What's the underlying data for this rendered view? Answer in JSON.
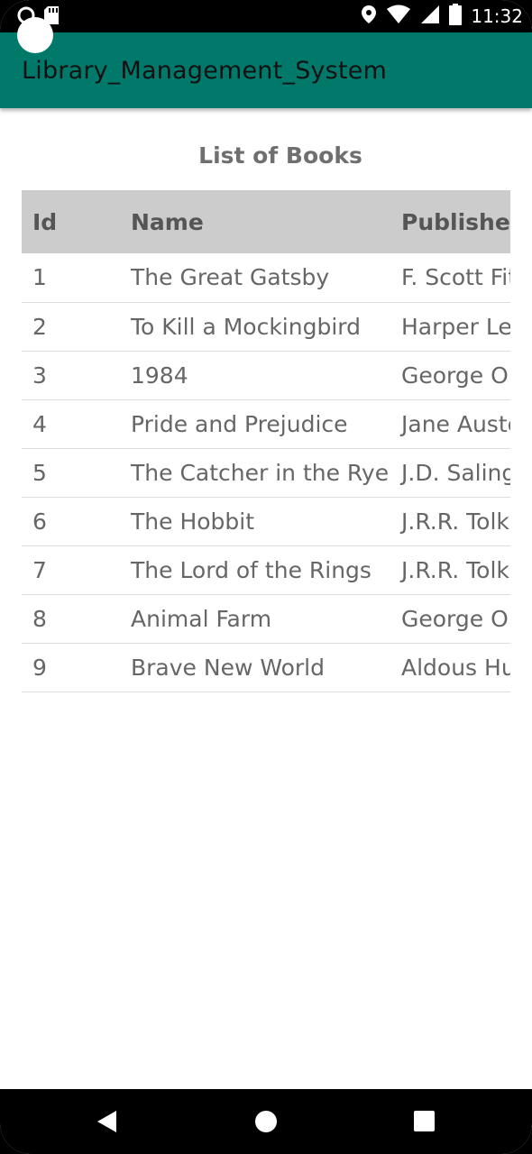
{
  "status_bar": {
    "time": "11:32",
    "icons": [
      "camera-notification-icon",
      "sd-card-icon",
      "location-icon",
      "wifi-icon",
      "signal-icon",
      "battery-icon"
    ]
  },
  "app_bar": {
    "title": "Library_Management_System",
    "color": "#00796b"
  },
  "content": {
    "title": "List of Books",
    "table": {
      "headers": {
        "id": "Id",
        "name": "Name",
        "publisher": "Publisher"
      },
      "rows": [
        {
          "id": "1",
          "name": "The Great Gatsby",
          "publisher": "F. Scott Fitzgerald"
        },
        {
          "id": "2",
          "name": "To Kill a Mockingbird",
          "publisher": "Harper Lee"
        },
        {
          "id": "3",
          "name": "1984",
          "publisher": "George Orwell"
        },
        {
          "id": "4",
          "name": "Pride and Prejudice",
          "publisher": "Jane Austen"
        },
        {
          "id": "5",
          "name": "The Catcher in the Rye",
          "publisher": "J.D. Salinger"
        },
        {
          "id": "6",
          "name": "The Hobbit",
          "publisher": "J.R.R. Tolkien"
        },
        {
          "id": "7",
          "name": "The Lord of the Rings",
          "publisher": "J.R.R. Tolkien"
        },
        {
          "id": "8",
          "name": "Animal Farm",
          "publisher": "George Orwell"
        },
        {
          "id": "9",
          "name": "Brave New World",
          "publisher": "Aldous Huxley"
        }
      ]
    }
  },
  "nav_bar": {
    "buttons": [
      "back-icon",
      "home-icon",
      "recents-icon"
    ]
  }
}
